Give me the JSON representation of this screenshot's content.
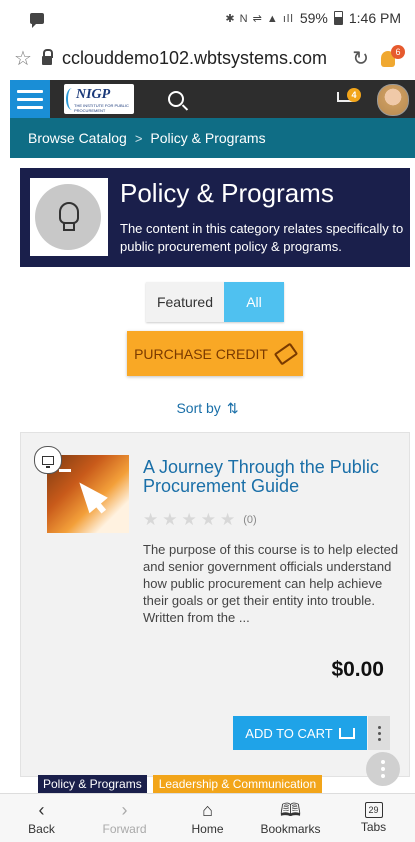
{
  "status_bar": {
    "battery": "59%",
    "time": "1:46 PM"
  },
  "browser": {
    "url": "cclouddemo102.wbtsystems.com",
    "notification_count": "6"
  },
  "header": {
    "logo_text": "NIGP",
    "logo_subtext": "THE INSTITUTE FOR PUBLIC PROCUREMENT",
    "cart_count": "4"
  },
  "breadcrumb": {
    "root": "Browse Catalog",
    "separator": ">",
    "current": "Policy & Programs"
  },
  "category": {
    "title": "Policy & Programs",
    "description": "The content in this category relates specifically to public procurement policy & programs."
  },
  "filter": {
    "featured_label": "Featured",
    "all_label": "All",
    "selected": "All"
  },
  "purchase_credit_label": "PURCHASE CREDIT",
  "sort_label": "Sort by",
  "course": {
    "title": "A Journey Through the Public Procurement Guide",
    "rating_count": "(0)",
    "description": "The purpose of this course is to help elected and senior government officials understand how public procurement can help achieve their goals or get their entity into trouble. Written from the ...",
    "price": "$0.00",
    "add_to_cart_label": "ADD TO CART",
    "tags": [
      "Policy & Programs",
      "Leadership & Communication"
    ]
  },
  "bottom_nav": {
    "back": "Back",
    "forward": "Forward",
    "home": "Home",
    "bookmarks": "Bookmarks",
    "tabs": "Tabs",
    "tabs_count": "29"
  },
  "colors": {
    "brand_dark": "#1a1f4b",
    "teal": "#0f6d85",
    "accent_blue": "#1fa3e8",
    "accent_orange": "#f9a825"
  }
}
